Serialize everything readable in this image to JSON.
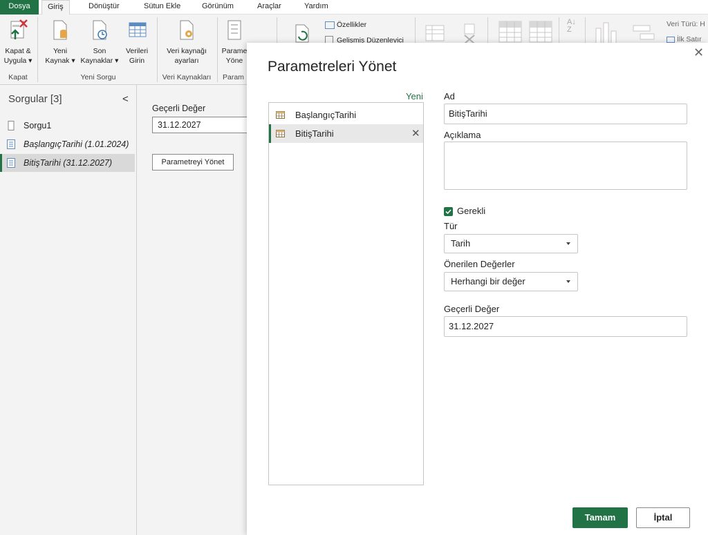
{
  "colors": {
    "accent": "#217346",
    "ribbon_bg": "#f3f3f3",
    "dialog_bg": "#ffffff"
  },
  "tabs": [
    "Dosya",
    "Giriş",
    "Dönüştür",
    "Sütun Ekle",
    "Görünüm",
    "Araçlar",
    "Yardım"
  ],
  "ribbon": {
    "close_apply": {
      "line1": "Kapat &",
      "line2": "Uygula ▾",
      "icon": "close-apply-icon"
    },
    "new_source": {
      "line1": "Yeni",
      "line2": "Kaynak ▾",
      "icon": "new-source-icon"
    },
    "recent_sources": {
      "line1": "Son",
      "line2": "Kaynaklar ▾",
      "icon": "recent-sources-icon"
    },
    "enter_data": {
      "line1": "Verileri",
      "line2": "Girin",
      "icon": "table-icon"
    },
    "data_source_settings": {
      "line1": "Veri kaynağı",
      "line2": "ayarları",
      "icon": "data-source-settings-icon"
    },
    "manage_params": {
      "line1": "Parame",
      "line2": "Yöne",
      "icon": "manage-parameters-icon"
    },
    "properties": "Özellikler",
    "advanced_editor": "Gelişmiş Düzenleyici",
    "data_type": "Veri Türü: H",
    "first_row": "İlk Satır",
    "groups": {
      "close": "Kapat",
      "new_query": "Yeni Sorgu",
      "data_sources": "Veri Kaynakları",
      "params": "Param"
    }
  },
  "queries": {
    "title": "Sorgular [3]",
    "collapse": "<",
    "items": [
      {
        "label": "Sorgu1",
        "italic": false
      },
      {
        "label": "BaşlangıçTarihi (1.01.2024)",
        "italic": true
      },
      {
        "label": "BitişTarihi (31.12.2027)",
        "italic": true
      }
    ]
  },
  "preview": {
    "current_value_label": "Geçerli Değer",
    "current_value": "31.12.2027",
    "manage_button": "Parametreyi Yönet"
  },
  "dialog": {
    "title": "Parametreleri Yönet",
    "close": "✕",
    "new_link": "Yeni",
    "params": [
      "BaşlangıçTarihi",
      "BitişTarihi"
    ],
    "delete": "✕",
    "name_label": "Ad",
    "name_value": "BitişTarihi",
    "desc_label": "Açıklama",
    "required_label": "Gerekli",
    "required": true,
    "type_label": "Tür",
    "type_value": "Tarih",
    "suggested_label": "Önerilen Değerler",
    "suggested_value": "Herhangi bir değer",
    "current_label": "Geçerli Değer",
    "current_value": "31.12.2027",
    "ok": "Tamam",
    "cancel": "İptal"
  }
}
